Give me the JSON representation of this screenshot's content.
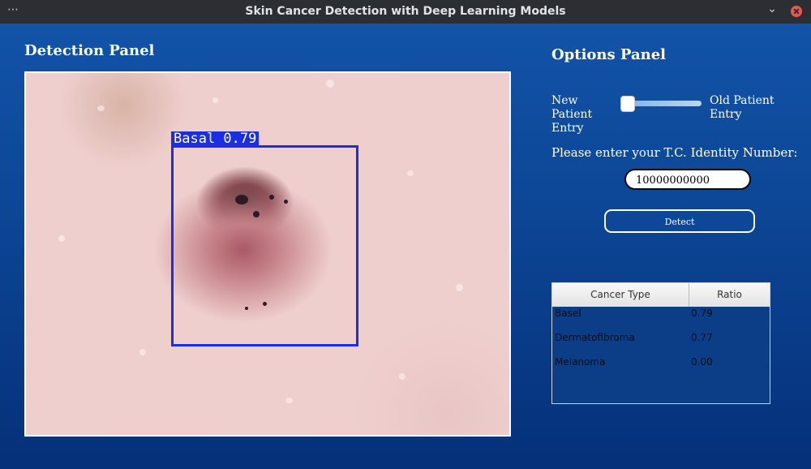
{
  "window": {
    "title": "Skin Cancer Detection with Deep Learning Models"
  },
  "titlebar_icons": {
    "menu": "⋯",
    "minimize": "⌄",
    "close": "close-icon"
  },
  "detection_panel": {
    "title": "Detection Panel",
    "detection": {
      "label": "Basal 0.79",
      "box_color": "#1c2fe0"
    }
  },
  "options_panel": {
    "title": "Options Panel",
    "slider": {
      "left_label": "New Patient Entry",
      "right_label": "Old Patient Entry",
      "value": 0
    },
    "prompt": "Please enter your T.C. Identity Number:",
    "id_input": {
      "value": "10000000000"
    },
    "detect_button": "Detect",
    "table": {
      "columns": [
        "Cancer Type",
        "Ratio"
      ],
      "rows": [
        {
          "type": "Basel",
          "ratio": "0.79"
        },
        {
          "type": "Dermatofibroma",
          "ratio": "0.77"
        },
        {
          "type": "Melanoma",
          "ratio": "0.00"
        }
      ]
    }
  },
  "colors": {
    "background": "#0b3e85",
    "accent": "#1c2fe0"
  }
}
